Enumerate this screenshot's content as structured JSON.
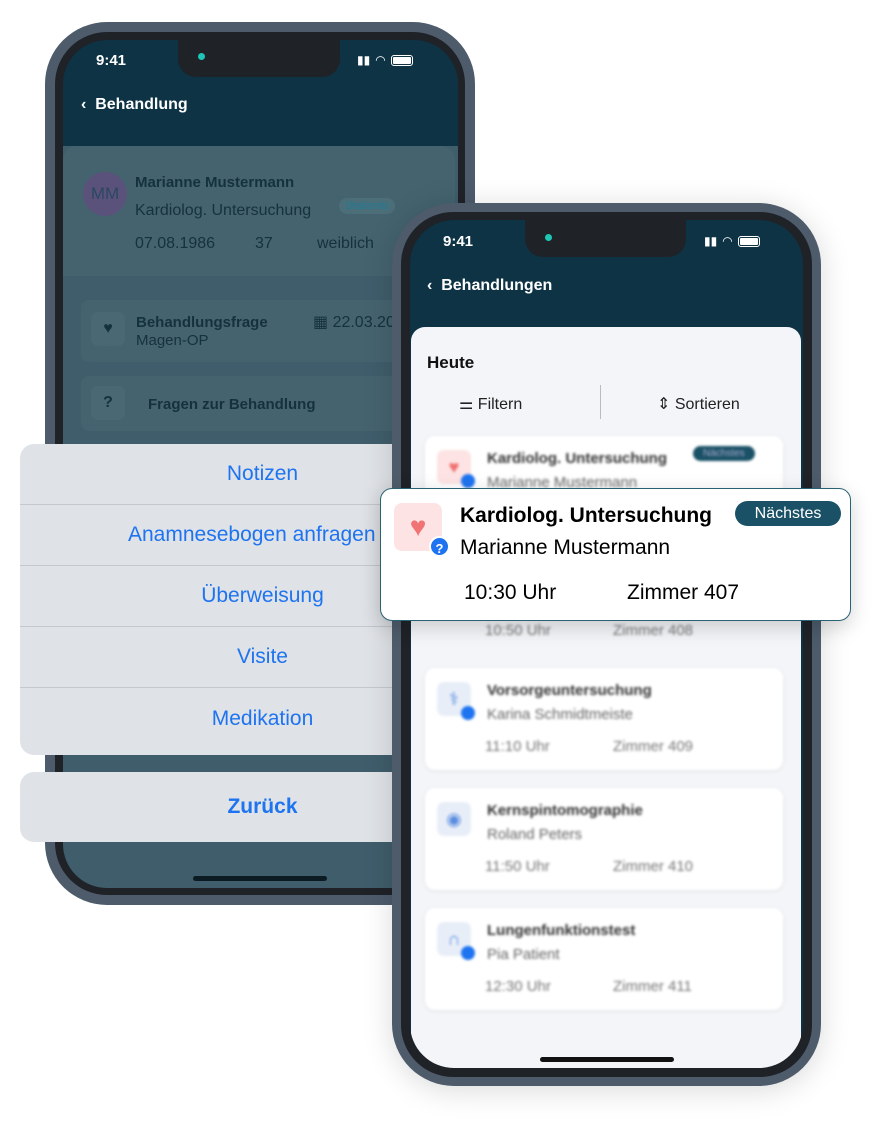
{
  "status": {
    "time": "9:41"
  },
  "left": {
    "header": {
      "title": "Behandlung"
    },
    "patient": {
      "initials": "MM",
      "name": "Marianne Mustermann",
      "exam": "Kardiolog. Untersuchung",
      "badge": "Stationär",
      "dob": "07.08.1986",
      "age": "37",
      "gender": "weiblich"
    },
    "question": {
      "title": "Behandlungsfrage",
      "subtitle": "Magen-OP",
      "date": "22.03.20"
    },
    "faq": {
      "title": "Fragen zur Behandlung"
    },
    "sheet": {
      "items": [
        "Notizen",
        "Anamnesebogen anfragen",
        "Überweisung",
        "Visite",
        "Medikation"
      ],
      "cancel": "Zurück"
    }
  },
  "right": {
    "header": {
      "title": "Behandlungen"
    },
    "section": "Heute",
    "filter": "Filtern",
    "sort": "Sortieren",
    "highlight": {
      "title": "Kardiolog. Untersuchung",
      "patient": "Marianne Mustermann",
      "time": "10:30 Uhr",
      "room": "Zimmer 407",
      "badge": "Nächstes"
    },
    "behind": {
      "title": "Kardiolog. Untersuchung",
      "patient": "Marianne Mustermann",
      "badge": "Nächstes",
      "time": "10:50 Uhr",
      "room": "Zimmer 408"
    },
    "items": [
      {
        "title": "Vorsorgeuntersuchung",
        "patient": "Karina Schmidtmeiste",
        "time": "11:10 Uhr",
        "room": "Zimmer 409"
      },
      {
        "title": "Kernspintomographie",
        "patient": "Roland Peters",
        "time": "11:50 Uhr",
        "room": "Zimmer 410"
      },
      {
        "title": "Lungenfunktionstest",
        "patient": "Pia Patient",
        "time": "12:30 Uhr",
        "room": "Zimmer 411"
      }
    ]
  },
  "colors": {
    "header": "#0e3345",
    "accent": "#1e74f0",
    "badge": "#1a5166"
  }
}
